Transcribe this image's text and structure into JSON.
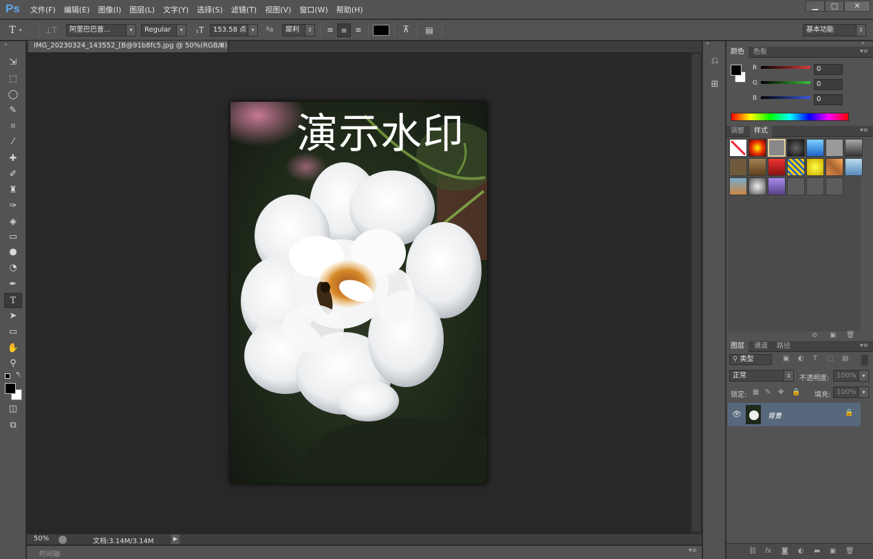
{
  "app": {
    "logo": "Ps"
  },
  "menu": [
    "文件(F)",
    "编辑(E)",
    "图像(I)",
    "图层(L)",
    "文字(Y)",
    "选择(S)",
    "滤镜(T)",
    "视图(V)",
    "窗口(W)",
    "帮助(H)"
  ],
  "window_controls": {
    "minimize": "▁",
    "maximize": "□",
    "close": "✕"
  },
  "options": {
    "font_family": "阿里巴巴普...",
    "font_style": "Regular",
    "font_size": "153.58 点",
    "antialias_label": "ªa",
    "antialias": "犀利",
    "text_color": "#000000",
    "workspace": "基本功能"
  },
  "document": {
    "tab_title": "IMG_20230324_143552_[B@91b8fc5.jpg @ 50%(RGB/8)",
    "tab_close": "×",
    "watermark_text": "演示水印"
  },
  "status": {
    "zoom": "50%",
    "doc_size": "文档:3.14M/3.14M"
  },
  "timeline": {
    "label": "时间轴"
  },
  "color_panel": {
    "tabs": [
      "颜色",
      "色板"
    ],
    "channels": [
      {
        "name": "R",
        "value": "0",
        "color": "#e03a3a"
      },
      {
        "name": "G",
        "value": "0",
        "color": "#39c23a"
      },
      {
        "name": "B",
        "value": "0",
        "color": "#3a56e0"
      }
    ]
  },
  "styles_panel": {
    "tabs": [
      "调整",
      "样式"
    ]
  },
  "layers_panel": {
    "tabs": [
      "图层",
      "通道",
      "路径"
    ],
    "filter": "类型",
    "blend_mode": "正常",
    "opacity_label": "不透明度:",
    "opacity": "100%",
    "lock_label": "锁定:",
    "fill_label": "填充:",
    "fill": "100%",
    "layers": [
      {
        "name": "背景",
        "locked": true
      }
    ]
  },
  "colors": {
    "accent": "#5fa8ea",
    "ui_bg": "#535353",
    "canvas_bg": "#282828",
    "selected_layer": "#58687c"
  }
}
